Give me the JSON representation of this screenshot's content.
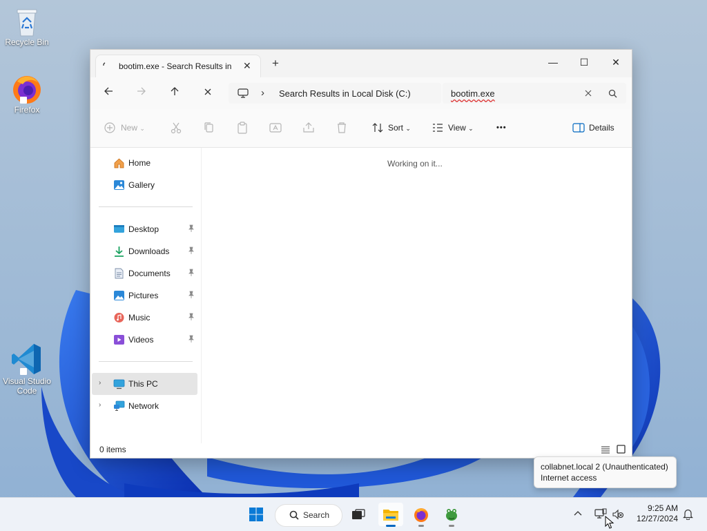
{
  "desktop": {
    "icons": [
      {
        "label": "Recycle Bin",
        "icon": "recycle-bin-icon"
      },
      {
        "label": "Firefox",
        "icon": "firefox-icon"
      },
      {
        "label": "Visual Studio Code",
        "icon": "vscode-icon"
      }
    ]
  },
  "window": {
    "tab_title": "bootim.exe - Search Results in",
    "tab_close": "✕",
    "new_tab": "+",
    "minimize": "—",
    "maximize": "☐",
    "close": "✕"
  },
  "address": {
    "breadcrumb_sep": "›",
    "location": "Search Results in Local Disk (C:)"
  },
  "search": {
    "value": "bootim.exe"
  },
  "commands": {
    "new": "New",
    "sort": "Sort",
    "view": "View",
    "more": "•••",
    "details": "Details"
  },
  "nav": {
    "home": "Home",
    "gallery": "Gallery",
    "pinned": [
      {
        "label": "Desktop",
        "icon": "desktop-folder-icon"
      },
      {
        "label": "Downloads",
        "icon": "downloads-icon"
      },
      {
        "label": "Documents",
        "icon": "documents-icon"
      },
      {
        "label": "Pictures",
        "icon": "pictures-icon"
      },
      {
        "label": "Music",
        "icon": "music-icon"
      },
      {
        "label": "Videos",
        "icon": "videos-icon"
      }
    ],
    "this_pc": "This PC",
    "network": "Network"
  },
  "content": {
    "working": "Working on it..."
  },
  "status": {
    "items": "0 items"
  },
  "taskbar": {
    "search_label": "Search",
    "clock_time": "9:25 AM",
    "clock_date": "12/27/2024"
  },
  "tooltip": {
    "line1": "collabnet.local 2 (Unauthenticated)",
    "line2": "Internet access"
  },
  "colors": {
    "accent": "#0067c0",
    "wallpaper_bg": "#9fb8d1",
    "bloom": "#1a56d8"
  }
}
